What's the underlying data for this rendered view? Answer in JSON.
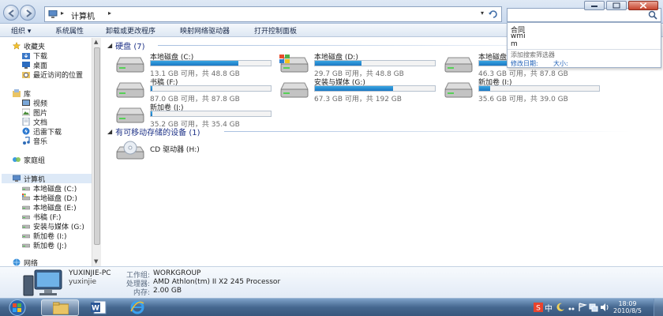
{
  "window": {
    "address_path": "计算机",
    "search_value": "",
    "search_suggestions": [
      "合同",
      "wmi",
      "m"
    ],
    "search_filter_hint": "添加搜索筛选器",
    "search_filter_links": [
      "修改日期:",
      "大小:"
    ]
  },
  "command_bar": {
    "organize": "组织 ▾",
    "system_properties": "系统属性",
    "uninstall": "卸载或更改程序",
    "map_drive": "映射网络驱动器",
    "control_panel": "打开控制面板"
  },
  "navigation": {
    "favorites": "收藏夹",
    "favorites_items": [
      "下载",
      "桌面",
      "最近访问的位置"
    ],
    "libraries": "库",
    "library_items": [
      "视频",
      "图片",
      "文档",
      "迅雷下载",
      "音乐"
    ],
    "homegroup": "家庭组",
    "computer": "计算机",
    "computer_items": [
      "本地磁盘 (C:)",
      "本地磁盘 (D:)",
      "本地磁盘 (E:)",
      "书稿 (F:)",
      "安装与媒体 (G:)",
      "新加卷 (I:)",
      "新加卷 (J:)"
    ],
    "network": "网络"
  },
  "content": {
    "hard_disks_header": "硬盘 (7)",
    "removable_header": "有可移动存储的设备 (1)",
    "drives": [
      {
        "name": "本地磁盘 (C:)",
        "free": "13.1 GB 可用，共 48.8 GB",
        "used_fraction": 0.73
      },
      {
        "name": "本地磁盘 (D:)",
        "free": "29.7 GB 可用，共 48.8 GB",
        "used_fraction": 0.39
      },
      {
        "name": "本地磁盘 (E:)",
        "free": "46.3 GB 可用，共 87.8 GB",
        "used_fraction": 0.47
      },
      {
        "name": "书稿 (F:)",
        "free": "87.0 GB 可用，共 87.8 GB",
        "used_fraction": 0.01
      },
      {
        "name": "安装与媒体 (G:)",
        "free": "67.3 GB 可用，共 192 GB",
        "used_fraction": 0.65
      },
      {
        "name": "新加卷 (I:)",
        "free": "35.6 GB 可用，共 39.0 GB",
        "used_fraction": 0.09
      },
      {
        "name": "新加卷 (J:)",
        "free": "35.2 GB 可用，共 35.4 GB",
        "used_fraction": 0.01
      }
    ],
    "removable": [
      {
        "name": "CD 驱动器 (H:)"
      }
    ]
  },
  "details": {
    "computer_name": "YUXINJIE-PC",
    "user": "yuxinjie",
    "workgroup_label": "工作组:",
    "workgroup": "WORKGROUP",
    "processor_label": "处理器:",
    "processor": "AMD Athlon(tm) II X2 245 Processor",
    "memory_label": "内存:",
    "memory": "2.00 GB"
  },
  "taskbar": {
    "time": "18:09",
    "date": "2010/8/5",
    "ime_label": "中"
  },
  "colors": {
    "drive_bar": "#1a77c4",
    "group_header": "#1e3287",
    "taskbar": "#45678f"
  }
}
